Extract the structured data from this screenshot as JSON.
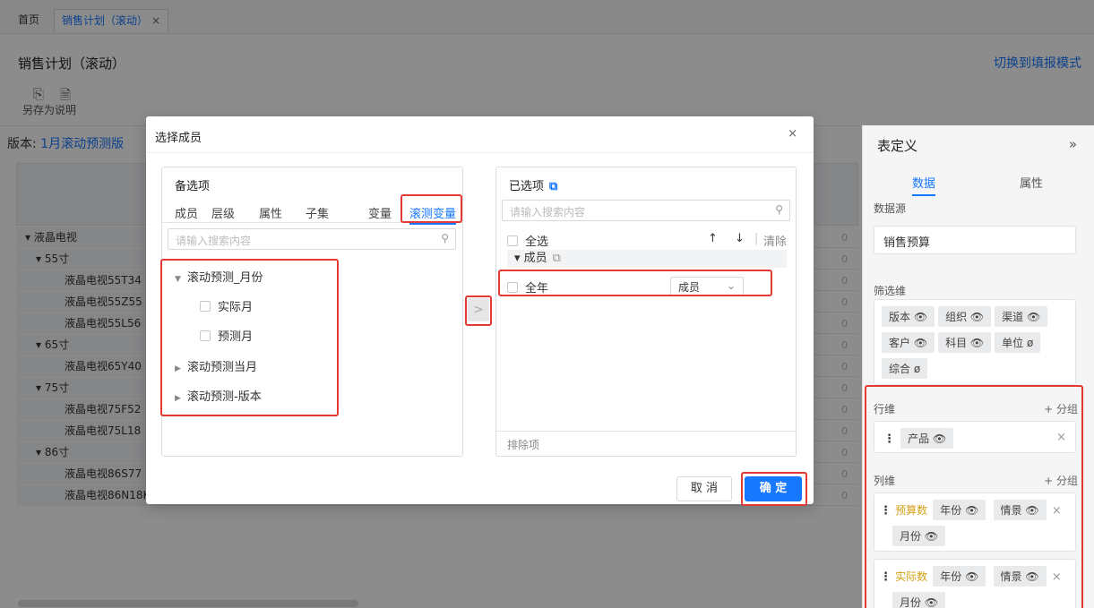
{
  "tabs": {
    "home": "首页",
    "active": "销售计划（滚动）",
    "close": "×"
  },
  "page": {
    "title": "销售计划（滚动）",
    "switch_link": "切换到填报模式"
  },
  "toolbar": {
    "save_as": "另存为",
    "note": "说明"
  },
  "version": {
    "label": "版本:",
    "value": "1月滚动预测版"
  },
  "grid_rows": [
    {
      "label": "▾ 液晶电视",
      "indent": 1
    },
    {
      "label": "▾ 55寸",
      "indent": 2
    },
    {
      "label": "液晶电视55T34",
      "indent": 3
    },
    {
      "label": "液晶电视55Z55",
      "indent": 3
    },
    {
      "label": "液晶电视55L56",
      "indent": 3
    },
    {
      "label": "▾ 65寸",
      "indent": 2
    },
    {
      "label": "液晶电视65Y40",
      "indent": 3
    },
    {
      "label": "▾ 75寸",
      "indent": 2
    },
    {
      "label": "液晶电视75F52",
      "indent": 3
    },
    {
      "label": "液晶电视75L18",
      "indent": 3
    },
    {
      "label": "▾ 86寸",
      "indent": 2
    },
    {
      "label": "液晶电视86S77",
      "indent": 3
    },
    {
      "label": "液晶电视86N18K",
      "indent": 3
    }
  ],
  "zero": "0",
  "right_panel": {
    "title": "表定义",
    "collapse": "»",
    "tab_data": "数据",
    "tab_attr": "属性",
    "datasource_label": "数据源",
    "datasource": "销售预算",
    "filter_label": "筛选维",
    "filters": [
      "版本 👁",
      "组织 👁",
      "渠道 👁",
      "客户 👁",
      "科目 👁",
      "单位 ø",
      "综合 ø"
    ],
    "row_label": "行维",
    "row_add": "+ 分组",
    "row_item": "产品 👁",
    "col_label": "列维",
    "col_add": "+ 分组",
    "col_group1": {
      "name": "预算数",
      "items": [
        "年份 👁",
        "情景 👁",
        "月份 👁"
      ]
    },
    "col_group2": {
      "name": "实际数",
      "items": [
        "年份 👁",
        "情景 👁",
        "月份 👁"
      ]
    },
    "remove": "×"
  },
  "modal": {
    "title": "选择成员",
    "close": "×",
    "left": {
      "title": "备选项",
      "tabs": [
        "成员",
        "层级",
        "属性",
        "子集",
        "变量",
        "滚测变量"
      ],
      "search_placeholder": "请输入搜索内容",
      "tree": [
        {
          "label": "滚动预测_月份",
          "type": "expanded"
        },
        {
          "label": "实际月",
          "type": "checkbox"
        },
        {
          "label": "预测月",
          "type": "checkbox"
        },
        {
          "label": "滚动预测当月",
          "type": "collapsed"
        },
        {
          "label": "滚动预测-版本",
          "type": "collapsed"
        }
      ]
    },
    "move_button": ">",
    "right": {
      "title": "已选项",
      "search_placeholder": "请输入搜索内容",
      "select_all": "全选",
      "up": "↑",
      "down": "↓",
      "divider": "|",
      "clear": "清除",
      "group": "▾ 成员",
      "item": "全年",
      "item_select": "成员",
      "exclude": "排除项"
    },
    "cancel": "取 消",
    "ok": "确 定"
  }
}
